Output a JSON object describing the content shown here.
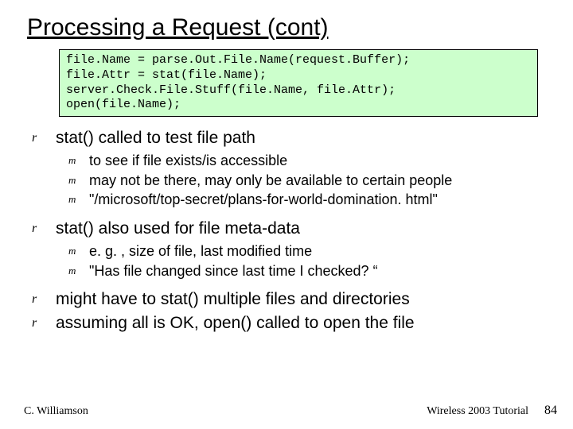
{
  "title": "Processing a Request (cont)",
  "code": "file.Name = parse.Out.File.Name(request.Buffer);\nfile.Attr = stat(file.Name);\nserver.Check.File.Stuff(file.Name, file.Attr);\nopen(file.Name);",
  "b1": "stat() called to test file path",
  "b1_s1": "to see if file exists/is accessible",
  "b1_s2": "may not be there, may only be available to certain people",
  "b1_s3": "\"/microsoft/top-secret/plans-for-world-domination. html\"",
  "b2": "stat() also used for file meta-data",
  "b2_s1": "e. g. , size of file, last modified time",
  "b2_s2": "\"Has file changed since last time I checked? “",
  "b3": "might have to stat() multiple files and directories",
  "b4": "assuming all is OK, open() called to open the file",
  "footer": {
    "author": "C. Williamson",
    "venue": "Wireless 2003 Tutorial",
    "page": "84"
  },
  "marks": {
    "r": "r",
    "m": "m"
  }
}
